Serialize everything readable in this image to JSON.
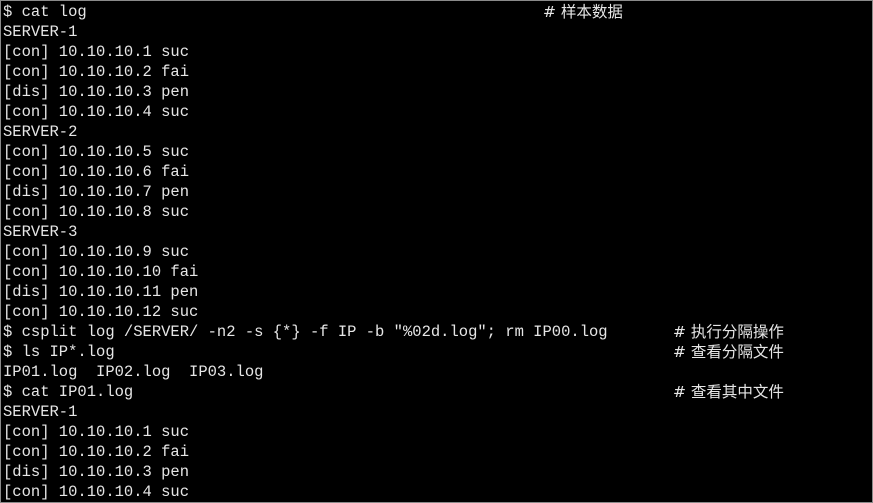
{
  "terminal": {
    "lines": [
      {
        "text": "$ cat log",
        "comment": "# 样本数据"
      },
      {
        "text": "SERVER-1"
      },
      {
        "text": "[con] 10.10.10.1 suc"
      },
      {
        "text": "[con] 10.10.10.2 fai"
      },
      {
        "text": "[dis] 10.10.10.3 pen"
      },
      {
        "text": "[con] 10.10.10.4 suc"
      },
      {
        "text": "SERVER-2"
      },
      {
        "text": "[con] 10.10.10.5 suc"
      },
      {
        "text": "[con] 10.10.10.6 fai"
      },
      {
        "text": "[dis] 10.10.10.7 pen"
      },
      {
        "text": "[con] 10.10.10.8 suc"
      },
      {
        "text": "SERVER-3"
      },
      {
        "text": "[con] 10.10.10.9 suc"
      },
      {
        "text": "[con] 10.10.10.10 fai"
      },
      {
        "text": "[dis] 10.10.10.11 pen"
      },
      {
        "text": "[con] 10.10.10.12 suc"
      },
      {
        "text": "$ csplit log /SERVER/ -n2 -s {*} -f IP -b \"%02d.log\"; rm IP00.log",
        "comment": "# 执行分隔操作"
      },
      {
        "text": "$ ls IP*.log",
        "comment": "# 查看分隔文件"
      },
      {
        "text": "IP01.log  IP02.log  IP03.log"
      },
      {
        "text": "$ cat IP01.log",
        "comment": "# 查看其中文件"
      },
      {
        "text": "SERVER-1"
      },
      {
        "text": "[con] 10.10.10.1 suc"
      },
      {
        "text": "[con] 10.10.10.2 fai"
      },
      {
        "text": "[dis] 10.10.10.3 pen"
      },
      {
        "text": "[con] 10.10.10.4 suc"
      }
    ]
  },
  "colors": {
    "background": "#000000",
    "foreground": "#e6e6e6",
    "border": "#8a8a8a"
  }
}
